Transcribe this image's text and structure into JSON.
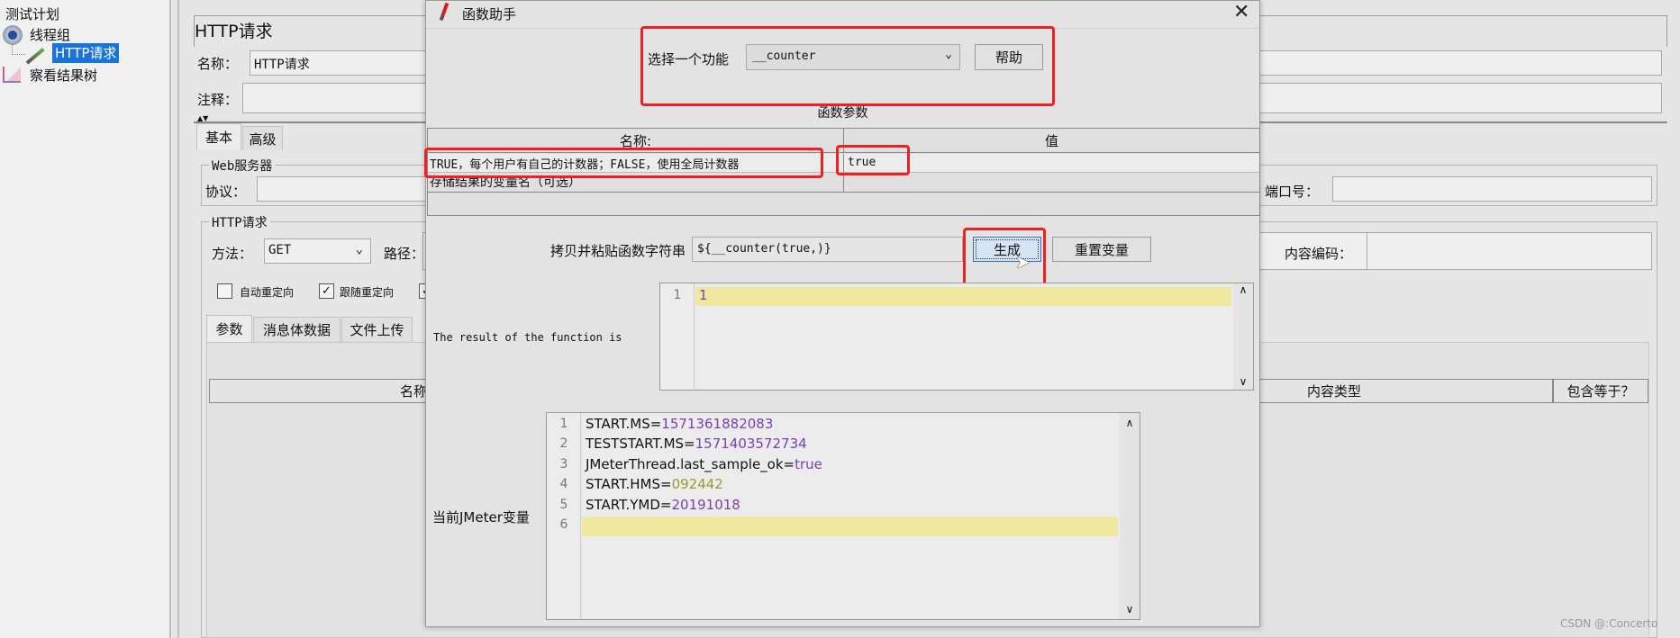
{
  "tree": {
    "items": [
      {
        "label": "测试计划",
        "icon": "test-plan-icon"
      },
      {
        "label": "线程组",
        "icon": "gear-icon"
      },
      {
        "label": "HTTP请求",
        "icon": "sampler-pipette-icon",
        "selected": true
      },
      {
        "label": "察看结果树",
        "icon": "graph-icon"
      }
    ]
  },
  "main": {
    "title": "HTTP请求",
    "name_label": "名称：",
    "name_value": "HTTP请求",
    "comment_label": "注释：",
    "tabs": [
      "基本",
      "高级"
    ],
    "web_server": {
      "legend": "Web服务器",
      "protocol_label": "协议：",
      "port_label": "端口号："
    },
    "http_request": {
      "legend": "HTTP请求",
      "method_label": "方法：",
      "method_value": "GET",
      "path_label": "路径：",
      "encoding_label": "内容编码："
    },
    "checkboxes": [
      {
        "label": "自动重定向",
        "checked": false
      },
      {
        "label": "跟随重定向",
        "checked": true
      },
      {
        "label": "",
        "checked": true
      }
    ],
    "sub_tabs": [
      "参数",
      "消息体数据",
      "文件上传"
    ],
    "table_headers": [
      "名称",
      "内容类型",
      "包含等于？"
    ]
  },
  "dialog": {
    "title": "函数助手",
    "select_label": "选择一个功能",
    "select_value": "__counter",
    "help_button": "帮助",
    "params_title": "函数参数",
    "params_headers": [
      "名称:",
      "值"
    ],
    "params_rows": [
      {
        "name": "TRUE，每个用户有自己的计数器；FALSE，使用全局计数器",
        "value": "true"
      },
      {
        "name": "存储结果的变量名（可选）",
        "value": ""
      }
    ],
    "copy_label": "拷贝并粘贴函数字符串",
    "copy_value": "${__counter(true,)}",
    "generate_button": "生成",
    "reset_button": "重置变量",
    "result_label": "The result of the function is",
    "result_lines": [
      "1"
    ],
    "vars_label": "当前JMeter变量",
    "vars_lines": [
      {
        "key": "START.MS=",
        "val": "1571361882083"
      },
      {
        "key": "TESTSTART.MS=",
        "val": "1571403572734"
      },
      {
        "key": "JMeterThread.last_sample_ok=",
        "val": "true"
      },
      {
        "key": "START.HMS=",
        "val": "092442"
      },
      {
        "key": "START.YMD=",
        "val": "20191018"
      },
      {
        "key": "",
        "val": ""
      }
    ]
  },
  "watermark": "CSDN @:Concerto",
  "colors": {
    "highlight_red": "#f02020",
    "selection": "#1a73d9",
    "line_highlight": "#efe8a0",
    "number": "#7a3fb0"
  }
}
